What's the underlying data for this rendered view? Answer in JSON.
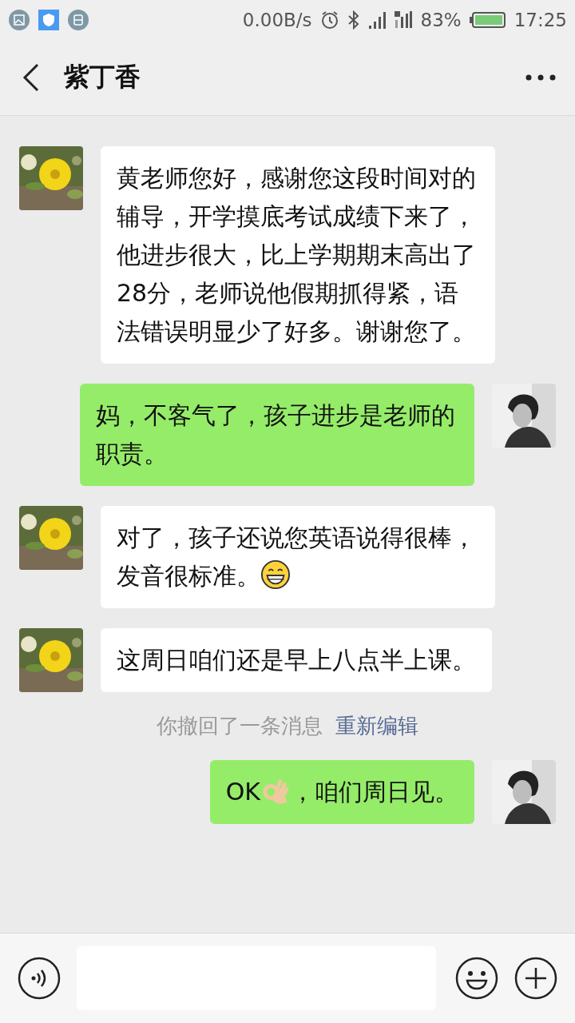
{
  "status_bar": {
    "speed": "0.00B/s",
    "battery": "83%",
    "time": "17:25"
  },
  "header": {
    "title": "紫丁香"
  },
  "messages": [
    {
      "kind": "incoming",
      "segments": [
        {
          "kind": "text",
          "text": "黄老师您好，感谢您这段时间对的辅导，开学摸底考试成绩下来了，他进步很大，比上学期期末高出了28分，老师说他假期抓得紧，语法错误明显少了好多。谢谢您了。"
        }
      ]
    },
    {
      "kind": "outgoing",
      "segments": [
        {
          "kind": "text",
          "text": "妈，不客气了，孩子进步是老师的职责。"
        }
      ]
    },
    {
      "kind": "incoming",
      "segments": [
        {
          "kind": "text",
          "text": "对了，孩子还说您英语说得很棒，发音很标准。"
        },
        {
          "kind": "grin"
        }
      ]
    },
    {
      "kind": "incoming",
      "segments": [
        {
          "kind": "text",
          "text": "这周日咱们还是早上八点半上课。"
        }
      ]
    },
    {
      "kind": "notice",
      "text": "你撤回了一条消息",
      "link": "重新编辑"
    },
    {
      "kind": "outgoing",
      "segments": [
        {
          "kind": "text",
          "text": "OK"
        },
        {
          "kind": "ok_hand"
        },
        {
          "kind": "text",
          "text": "，咱们周日见。"
        }
      ]
    }
  ]
}
